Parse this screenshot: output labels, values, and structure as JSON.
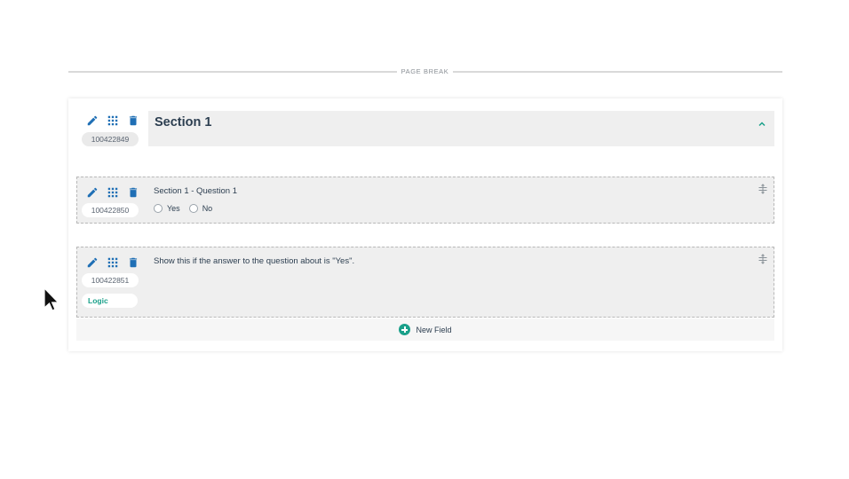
{
  "page_break": {
    "label": "PAGE BREAK"
  },
  "section": {
    "title": "Section 1",
    "id": "100422849"
  },
  "fields": [
    {
      "id": "100422850",
      "label": "Section 1 - Question 1",
      "options": [
        "Yes",
        "No"
      ]
    },
    {
      "id": "100422851",
      "label": "Show this if the answer to the question about is \"Yes\".",
      "logic_label": "Logic"
    }
  ],
  "new_field": {
    "label": "New Field"
  },
  "icons": [
    "pencil-icon",
    "grid-icon",
    "trash-icon",
    "chevron-up-icon",
    "drag-handle-icon",
    "plus-circle-icon",
    "mouse-pointer-icon"
  ],
  "colors": {
    "accent": "#1aa08a",
    "icon_blue": "#1f6fb5",
    "panel": "#efefef",
    "text": "#2c3e50"
  }
}
